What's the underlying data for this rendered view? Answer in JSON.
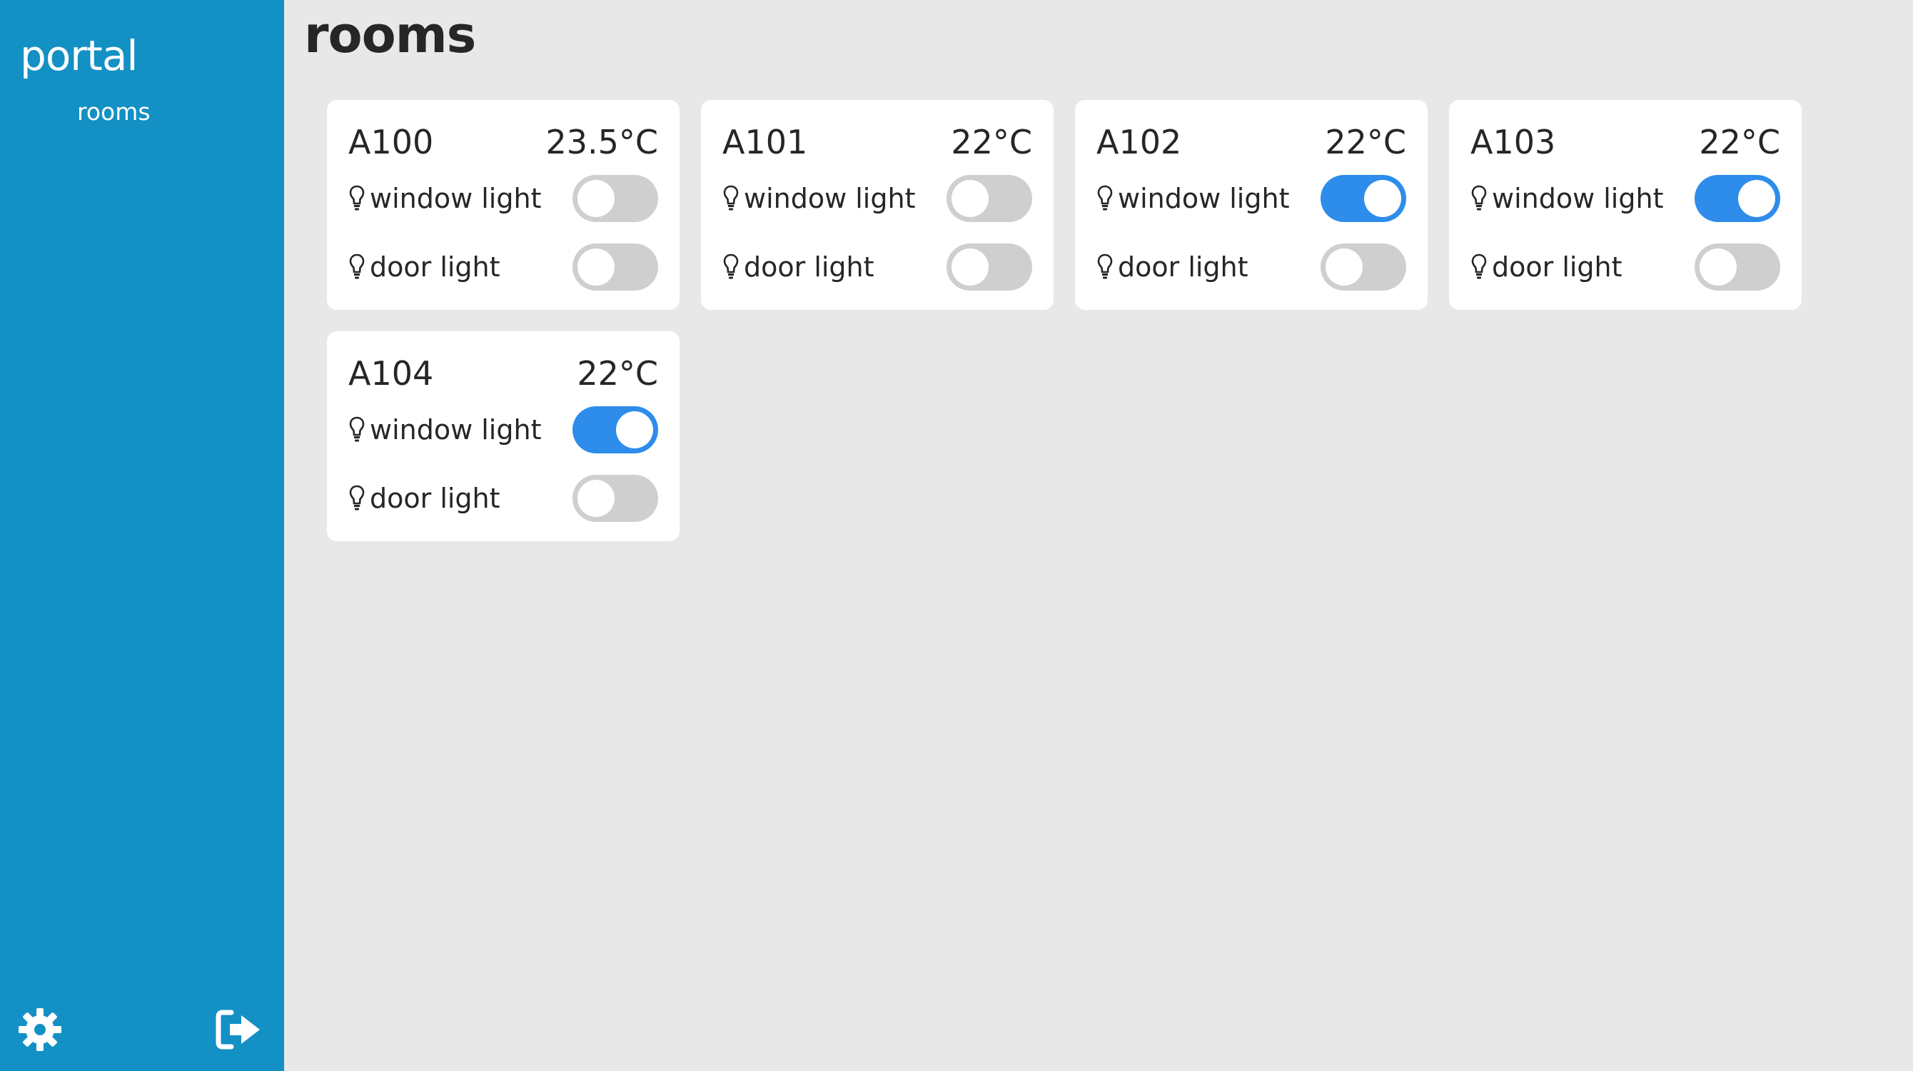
{
  "sidebar": {
    "brand": "portal",
    "nav_items": [
      {
        "label": "rooms"
      }
    ],
    "settings_icon": "gear-icon",
    "logout_icon": "sign-out-icon"
  },
  "main": {
    "title": "rooms"
  },
  "colors": {
    "sidebar_bg": "#1390c4",
    "toggle_on": "#2e8ceb",
    "toggle_off": "#cfcfcf",
    "page_bg": "#e8e8e8"
  },
  "rooms": [
    {
      "name": "A100",
      "temperature": "23.5°C",
      "lights": [
        {
          "label": "window light",
          "icon": "lightbulb-icon",
          "on": false
        },
        {
          "label": "door light",
          "icon": "lightbulb-icon",
          "on": false
        }
      ]
    },
    {
      "name": "A101",
      "temperature": "22°C",
      "lights": [
        {
          "label": "window light",
          "icon": "lightbulb-icon",
          "on": false
        },
        {
          "label": "door light",
          "icon": "lightbulb-icon",
          "on": false
        }
      ]
    },
    {
      "name": "A102",
      "temperature": "22°C",
      "lights": [
        {
          "label": "window light",
          "icon": "lightbulb-icon",
          "on": true
        },
        {
          "label": "door light",
          "icon": "lightbulb-icon",
          "on": false
        }
      ]
    },
    {
      "name": "A103",
      "temperature": "22°C",
      "lights": [
        {
          "label": "window light",
          "icon": "lightbulb-icon",
          "on": true
        },
        {
          "label": "door light",
          "icon": "lightbulb-icon",
          "on": false
        }
      ]
    },
    {
      "name": "A104",
      "temperature": "22°C",
      "lights": [
        {
          "label": "window light",
          "icon": "lightbulb-icon",
          "on": true
        },
        {
          "label": "door light",
          "icon": "lightbulb-icon",
          "on": false
        }
      ]
    }
  ]
}
